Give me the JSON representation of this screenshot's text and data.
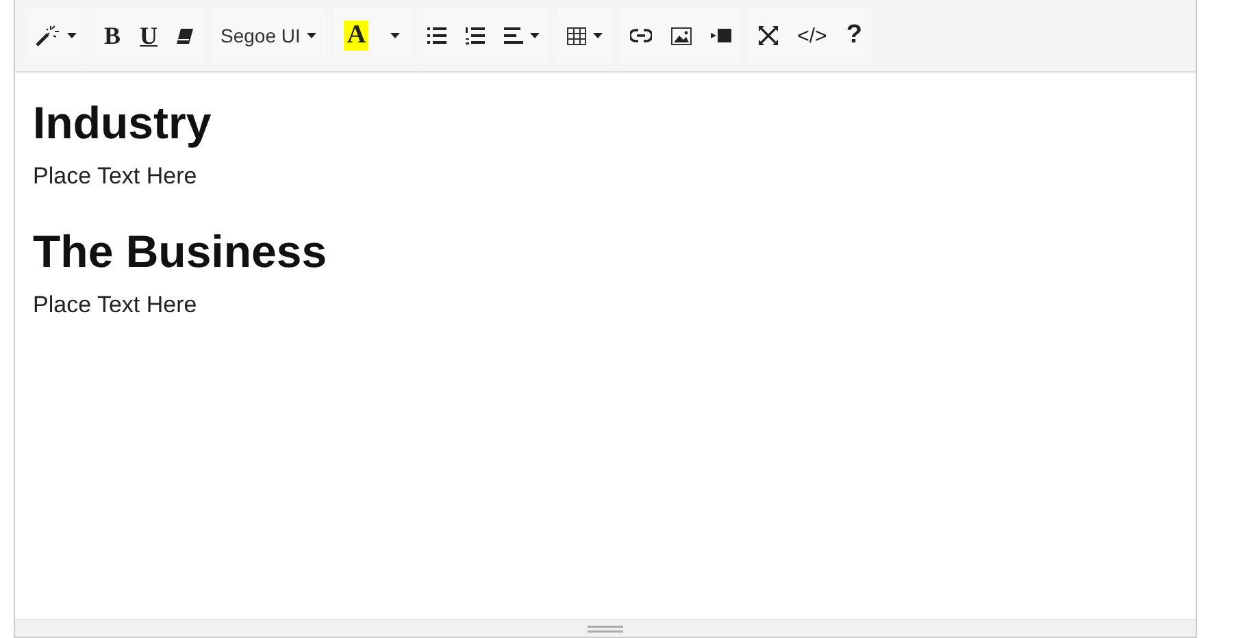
{
  "toolbar": [
    {
      "buttons": [
        {
          "kind": "wand",
          "caret": true
        }
      ]
    },
    {
      "buttons": [
        {
          "kind": "bold",
          "label": "B",
          "caret": false
        },
        {
          "kind": "underline",
          "label": "U",
          "caret": false
        },
        {
          "kind": "eraser",
          "caret": false
        }
      ]
    },
    {
      "buttons": [
        {
          "kind": "font",
          "label": "Segoe UI",
          "caret": true
        }
      ]
    },
    {
      "buttons": [
        {
          "kind": "color",
          "label": "A",
          "color": "#ffff00",
          "caret": false
        },
        {
          "kind": "dropdown",
          "caret": true
        }
      ]
    },
    {
      "buttons": [
        {
          "kind": "bullets",
          "caret": false
        },
        {
          "kind": "numbers",
          "caret": false
        },
        {
          "kind": "align",
          "caret": true
        }
      ]
    },
    {
      "buttons": [
        {
          "kind": "table",
          "caret": true
        }
      ]
    },
    {
      "buttons": [
        {
          "kind": "link",
          "caret": false
        },
        {
          "kind": "image",
          "caret": false
        },
        {
          "kind": "video",
          "caret": false
        }
      ]
    },
    {
      "buttons": [
        {
          "kind": "fullscreen",
          "caret": false
        },
        {
          "kind": "code",
          "label": "</>",
          "caret": false
        },
        {
          "kind": "help",
          "label": "?",
          "caret": false
        }
      ]
    }
  ],
  "content": [
    {
      "kind": "heading",
      "text": "Industry"
    },
    {
      "kind": "paragraph",
      "text": "Place Text Here"
    },
    {
      "kind": "heading",
      "text": "The Business"
    },
    {
      "kind": "paragraph",
      "text": "Place Text Here"
    }
  ]
}
